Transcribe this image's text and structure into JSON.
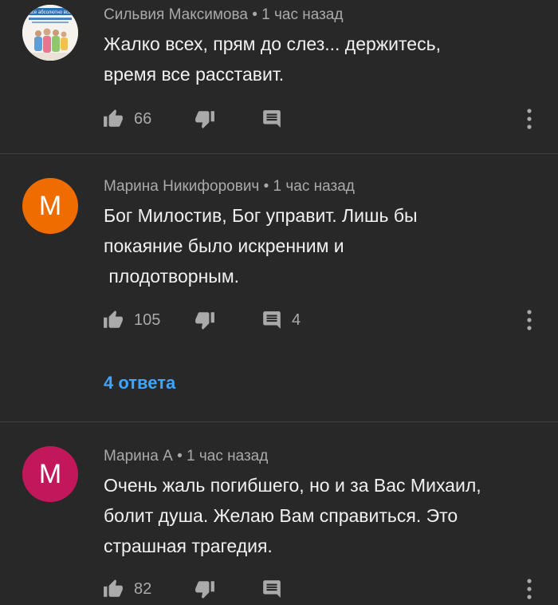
{
  "comments": [
    {
      "author": "Сильвия Максимова",
      "time": "1 час назад",
      "text": "Жалко всех, прям до слез... держитесь,\nвремя все расставит.",
      "likes": "66",
      "replies_count": "",
      "avatar_letter": "",
      "avatar_color": "#f4f4f4",
      "avatar_banner_text": "все абсолютно все"
    },
    {
      "author": "Марина Никифорович",
      "time": "1 час назад",
      "text": "Бог Милостив, Бог управит. Лишь бы\nпокаяние было искренним и\n плодотворным.",
      "likes": "105",
      "replies_count": "4",
      "replies_link": "4 ответа",
      "avatar_letter": "M",
      "avatar_color": "#ef6c00"
    },
    {
      "author": "Марина А",
      "time": "1 час назад",
      "text": "Очень жаль погибшего, но и за Вас Михаил,\nболит душа. Желаю Вам справиться. Это\nстрашная трагедия.",
      "likes": "82",
      "replies_count": "",
      "avatar_letter": "M",
      "avatar_color": "#c2185b"
    }
  ],
  "meta_separator": " • ",
  "colors": {
    "background": "#282828",
    "text": "#f1f1f1",
    "secondary": "#aaaaaa",
    "link": "#3ea6ff"
  },
  "icons": {
    "like": "thumb-up-icon",
    "dislike": "thumb-down-icon",
    "reply": "comment-icon",
    "more": "more-vert-icon"
  }
}
